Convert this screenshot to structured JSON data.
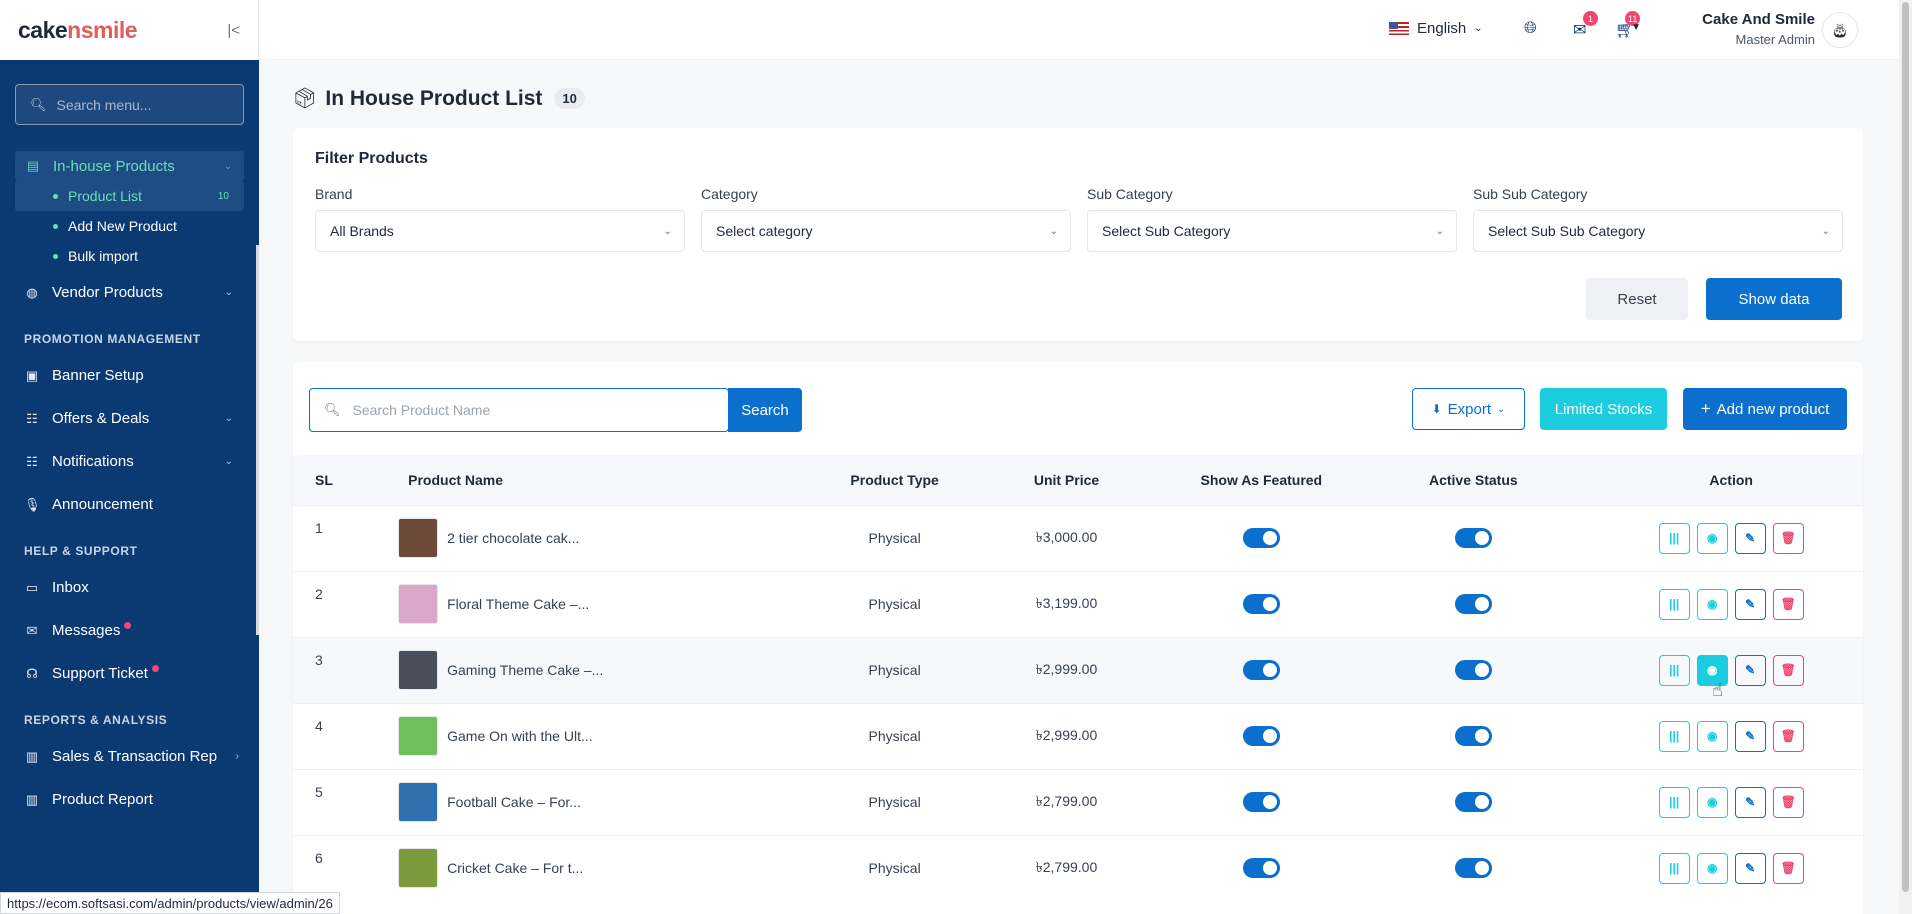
{
  "sidebar": {
    "logo": {
      "part1": "cake",
      "part2": "n",
      "part3": "smile"
    },
    "search_placeholder": "Search menu...",
    "in_house": {
      "label": "In-house Products"
    },
    "sub_items": [
      {
        "label": "Product List",
        "count": "10"
      },
      {
        "label": "Add New Product"
      },
      {
        "label": "Bulk import"
      }
    ],
    "vendor": {
      "label": "Vendor Products"
    },
    "section_promo": "PROMOTION MANAGEMENT",
    "banner": {
      "label": "Banner Setup"
    },
    "offers": {
      "label": "Offers & Deals"
    },
    "notifications": {
      "label": "Notifications"
    },
    "announcement": {
      "label": "Announcement"
    },
    "section_help": "HELP & SUPPORT",
    "inbox": {
      "label": "Inbox"
    },
    "messages": {
      "label": "Messages"
    },
    "support": {
      "label": "Support Ticket"
    },
    "section_reports": "REPORTS & ANALYSIS",
    "sales": {
      "label": "Sales & Transaction Rep"
    },
    "product_report": {
      "label": "Product Report"
    }
  },
  "header": {
    "language": "English",
    "mail_badge": "1",
    "cart_badge": "11",
    "user_name": "Cake And Smile",
    "user_role": "Master Admin"
  },
  "page": {
    "title": "In House Product List",
    "count": "10"
  },
  "filter": {
    "title": "Filter Products",
    "brand_label": "Brand",
    "brand_value": "All Brands",
    "category_label": "Category",
    "category_value": "Select category",
    "sub_category_label": "Sub Category",
    "sub_category_value": "Select Sub Category",
    "sub_sub_category_label": "Sub Sub Category",
    "sub_sub_category_value": "Select Sub Sub Category",
    "reset": "Reset",
    "show": "Show data"
  },
  "list": {
    "search_placeholder": "Search Product Name",
    "search_button": "Search",
    "export": "Export",
    "limited": "Limited Stocks",
    "add_new": "Add new product",
    "columns": [
      "SL",
      "Product Name",
      "Product Type",
      "Unit Price",
      "Show As Featured",
      "Active Status",
      "Action"
    ],
    "rows": [
      {
        "sl": "1",
        "name": "2 tier chocolate cak...",
        "type": "Physical",
        "price": "৳3,000.00",
        "thumb": "#6b4a3a"
      },
      {
        "sl": "2",
        "name": "Floral Theme Cake –...",
        "type": "Physical",
        "price": "৳3,199.00",
        "thumb": "#d9a7c7"
      },
      {
        "sl": "3",
        "name": "Gaming Theme Cake –...",
        "type": "Physical",
        "price": "৳2,999.00",
        "thumb": "#4a4f5c"
      },
      {
        "sl": "4",
        "name": "Game On with the Ult...",
        "type": "Physical",
        "price": "৳2,999.00",
        "thumb": "#6fbf5f"
      },
      {
        "sl": "5",
        "name": "Football Cake – For...",
        "type": "Physical",
        "price": "৳2,799.00",
        "thumb": "#2f6fb0"
      },
      {
        "sl": "6",
        "name": "Cricket Cake – For t...",
        "type": "Physical",
        "price": "৳2,799.00",
        "thumb": "#7a9a3c"
      }
    ]
  },
  "status_url": "https://ecom.softsasi.com/admin/products/view/admin/26"
}
